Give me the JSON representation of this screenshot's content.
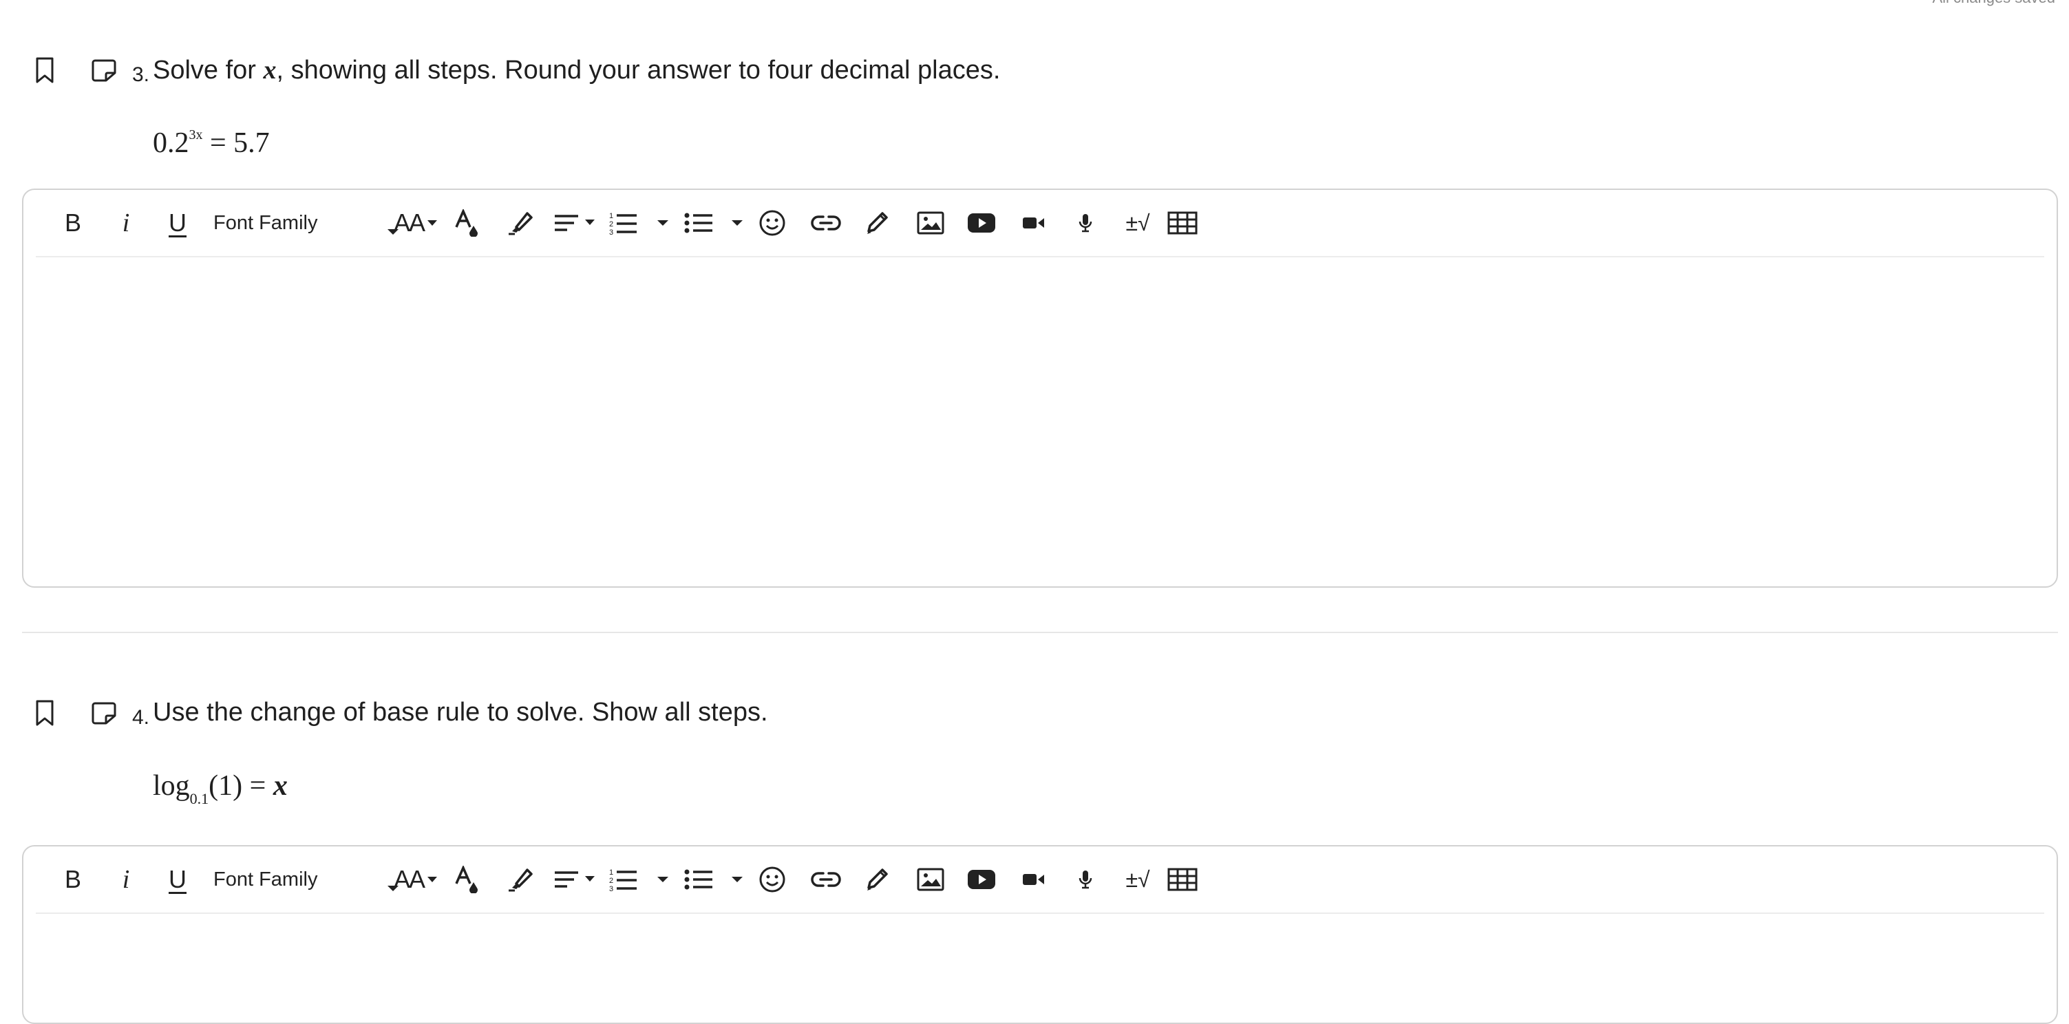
{
  "status": {
    "save_text": "All changes saved"
  },
  "questions": [
    {
      "number": "3.",
      "text_before": "Solve for ",
      "variable": "x",
      "text_after": ", showing all steps. Round your answer to four decimal places.",
      "formula": {
        "base": "0.2",
        "exponent": "3x",
        "rest": " = 5.7"
      }
    },
    {
      "number": "4.",
      "text_before": "Use the change of base rule to solve. Show all steps.",
      "variable": "",
      "text_after": "",
      "formula": {
        "func": "log",
        "subscript": "0.1",
        "arg": "(1) = ",
        "var": "x"
      }
    }
  ],
  "toolbar": {
    "bold": "B",
    "italic": "i",
    "underline": "U",
    "font_family": "Font Family",
    "font_size": "AA",
    "math": "±√"
  },
  "icons": [
    "bookmark-icon",
    "note-icon",
    "text-color-icon",
    "highlighter-icon",
    "align-icon",
    "numbered-list-icon",
    "bulleted-list-icon",
    "emoji-icon",
    "link-icon",
    "pencil-icon",
    "image-icon",
    "youtube-icon",
    "video-icon",
    "microphone-icon",
    "math-icon",
    "table-icon"
  ]
}
